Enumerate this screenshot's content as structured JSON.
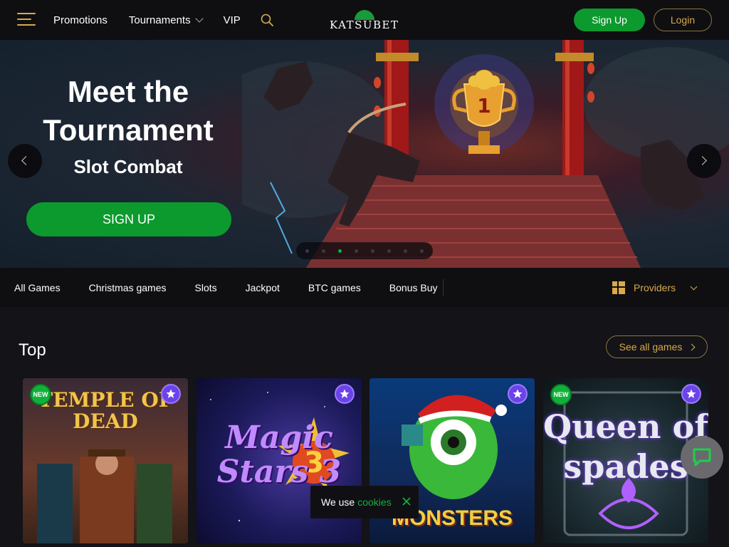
{
  "header": {
    "nav": [
      {
        "label": "Promotions"
      },
      {
        "label": "Tournaments"
      },
      {
        "label": "VIP"
      }
    ],
    "logo_text": "KATSUBET",
    "signup_label": "Sign Up",
    "login_label": "Login"
  },
  "hero": {
    "title": "Meet the Tournament",
    "subtitle": "Slot Combat",
    "cta_label": "SIGN UP",
    "trophy_number": "1",
    "slide_count": 8,
    "active_slide": 3
  },
  "categories": {
    "items": [
      "All Games",
      "Christmas games",
      "Slots",
      "Jackpot",
      "BTC games",
      "Bonus Buy"
    ],
    "providers_label": "Providers"
  },
  "top": {
    "title": "Top",
    "see_all_label": "See all games",
    "games": [
      {
        "title": "TEMPLE OF DEAD",
        "new": true,
        "new_label": "NEW"
      },
      {
        "title": "Magic Stars 3",
        "new": false
      },
      {
        "title": "MONSTERS",
        "new": false
      },
      {
        "title": "Queen of spades",
        "new": true,
        "new_label": "NEW"
      }
    ]
  },
  "cookie": {
    "text": "We use",
    "link_text": "cookies"
  },
  "colors": {
    "accent_green": "#0c9a2e",
    "gold": "#d9a94a",
    "background": "#131318",
    "favorite_purple": "#6c43e8"
  },
  "icons": [
    "menu-icon",
    "chevron-down-icon",
    "search-icon",
    "chevron-left-icon",
    "chevron-right-icon",
    "grid-icon",
    "star-icon",
    "close-icon",
    "chat-icon",
    "trophy-icon"
  ]
}
